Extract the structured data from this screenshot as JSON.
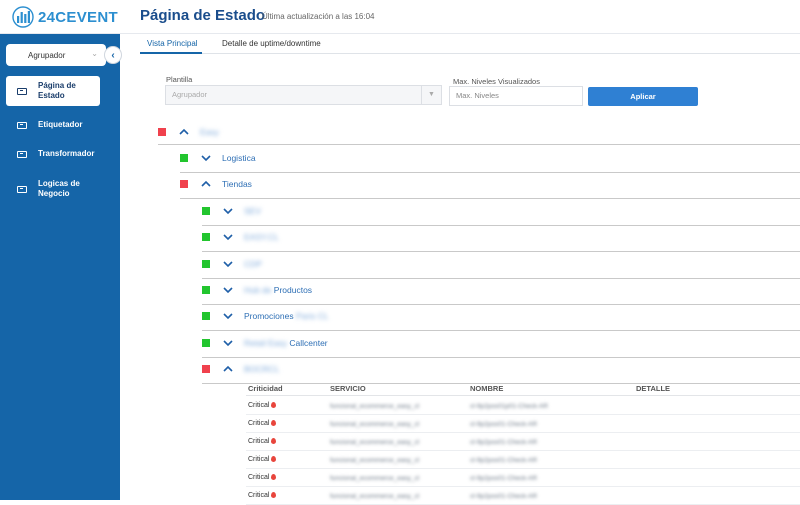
{
  "header": {
    "logo_text": "24CEVENT",
    "title": "Página de Estado",
    "updated": "Última actualización a las 16:04"
  },
  "sidebar": {
    "agrupador": "Agrupador",
    "items": [
      {
        "label": "Página de Estado",
        "active": true,
        "icon": "id-card-icon"
      },
      {
        "label": "Etiquetador",
        "active": false,
        "icon": "id-card-icon"
      },
      {
        "label": "Transformador",
        "active": false,
        "icon": "id-card-icon"
      },
      {
        "label": "Logicas de Negocio",
        "active": false,
        "icon": "id-card-icon"
      }
    ]
  },
  "tabs": [
    {
      "label": "Vista Principal",
      "active": true
    },
    {
      "label": "Detalle de uptime/downtime",
      "active": false
    }
  ],
  "filters": {
    "plantilla_label": "Plantilla",
    "plantilla_placeholder": "Agrupador",
    "max_label": "Max. Niveles Visualizados",
    "max_placeholder": "Max. Niveles",
    "apply_label": "Aplicar"
  },
  "tree": [
    {
      "text": "Easy",
      "blurred": true,
      "status": "red",
      "expanded": true,
      "level": 0
    },
    {
      "text": "Logistica",
      "blurred": false,
      "status": "green",
      "expanded": false,
      "level": 1
    },
    {
      "text": "Tiendas",
      "blurred": false,
      "status": "red",
      "expanded": true,
      "level": 1
    },
    {
      "text": "SEV",
      "blurred": true,
      "status": "green",
      "expanded": false,
      "level": 2
    },
    {
      "text": "EASY.CL",
      "blurred": true,
      "status": "green",
      "expanded": false,
      "level": 2
    },
    {
      "text": "CDP",
      "blurred": true,
      "status": "green",
      "expanded": false,
      "level": 2
    },
    {
      "text": "Productos",
      "blurred_prefix": "Hub de",
      "status": "green",
      "expanded": false,
      "level": 2
    },
    {
      "text": "Promociones",
      "blurred_suffix": "Paris CL",
      "status": "green",
      "expanded": false,
      "level": 2
    },
    {
      "text": "Callcenter",
      "blurred_prefix": "Retail Easy",
      "status": "green",
      "expanded": false,
      "level": 2
    },
    {
      "text": "BOCRCL",
      "blurred": true,
      "status": "red",
      "expanded": true,
      "level": 2
    }
  ],
  "table": {
    "headers": [
      "Criticidad",
      "SERVICIO",
      "NOMBRE",
      "DETALLE"
    ],
    "rows": [
      {
        "criticidad": "Critical",
        "servicio": "funcional_ecommerce_easy_cl",
        "nombre": "cl-9p2pos01p01-Check-AR"
      },
      {
        "criticidad": "Critical",
        "servicio": "funcional_ecommerce_easy_cl",
        "nombre": "cl-9p2pos01-Check-AR"
      },
      {
        "criticidad": "Critical",
        "servicio": "funcional_ecommerce_easy_cl",
        "nombre": "cl-9p2pos01-Check-AR"
      },
      {
        "criticidad": "Critical",
        "servicio": "funcional_ecommerce_easy_cl",
        "nombre": "cl-9p2pos01-Check-AR"
      },
      {
        "criticidad": "Critical",
        "servicio": "funcional_ecommerce_easy_cl",
        "nombre": "cl-9p2pos01-Check-AR"
      },
      {
        "criticidad": "Critical",
        "servicio": "funcional_ecommerce_easy_cl",
        "nombre": "cl-9p2pos01-Check-AR"
      }
    ]
  },
  "colors": {
    "sidebar": "#1565a8",
    "accent": "#2f80d3",
    "status_red": "#f0414d",
    "status_green": "#22c52e",
    "link": "#2e6fb5"
  }
}
